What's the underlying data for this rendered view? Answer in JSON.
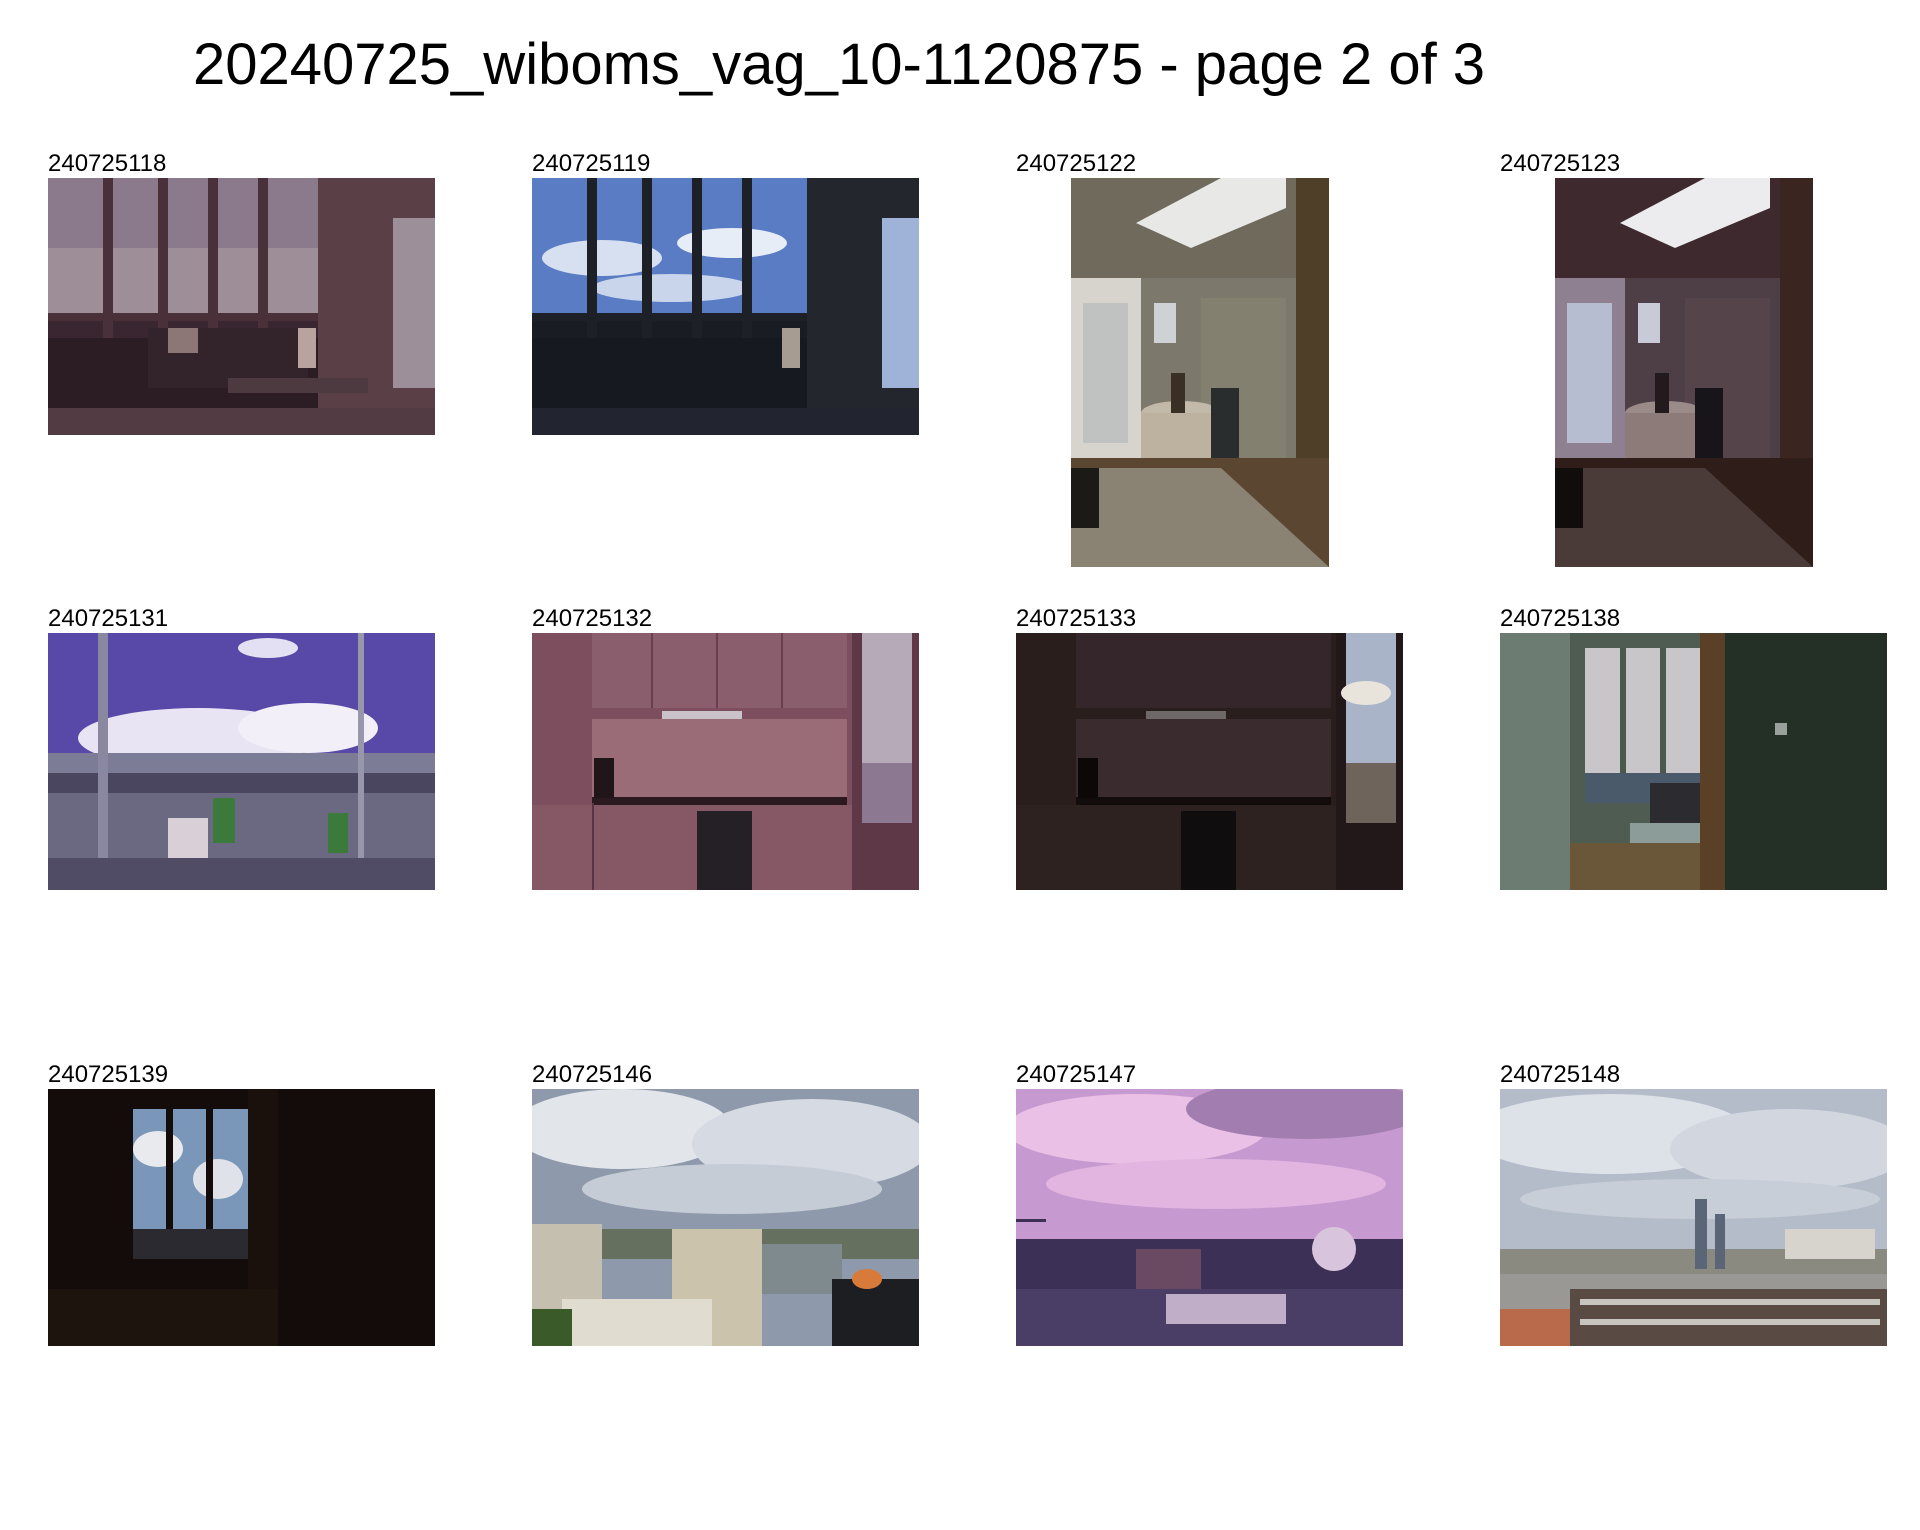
{
  "title": "20240725_wiboms_vag_10-1120875 - page 2 of 3",
  "thumbnails": [
    {
      "id": "240725118",
      "orientation": "landscape",
      "scene": "living-room-windows-dusk"
    },
    {
      "id": "240725119",
      "orientation": "landscape",
      "scene": "living-room-windows-blue-sky"
    },
    {
      "id": "240725122",
      "orientation": "portrait",
      "scene": "dining-nook-skylight"
    },
    {
      "id": "240725123",
      "orientation": "portrait",
      "scene": "dining-nook-skylight-dark"
    },
    {
      "id": "240725131",
      "orientation": "landscape",
      "scene": "balcony-purple-sky"
    },
    {
      "id": "240725132",
      "orientation": "landscape",
      "scene": "kitchen-pink"
    },
    {
      "id": "240725133",
      "orientation": "landscape",
      "scene": "kitchen-dark"
    },
    {
      "id": "240725138",
      "orientation": "landscape",
      "scene": "hallway-green"
    },
    {
      "id": "240725139",
      "orientation": "landscape",
      "scene": "hallway-dark"
    },
    {
      "id": "240725146",
      "orientation": "landscape",
      "scene": "city-view-clouds"
    },
    {
      "id": "240725147",
      "orientation": "landscape",
      "scene": "city-view-pink-sky"
    },
    {
      "id": "240725148",
      "orientation": "landscape",
      "scene": "city-view-skyline"
    }
  ]
}
